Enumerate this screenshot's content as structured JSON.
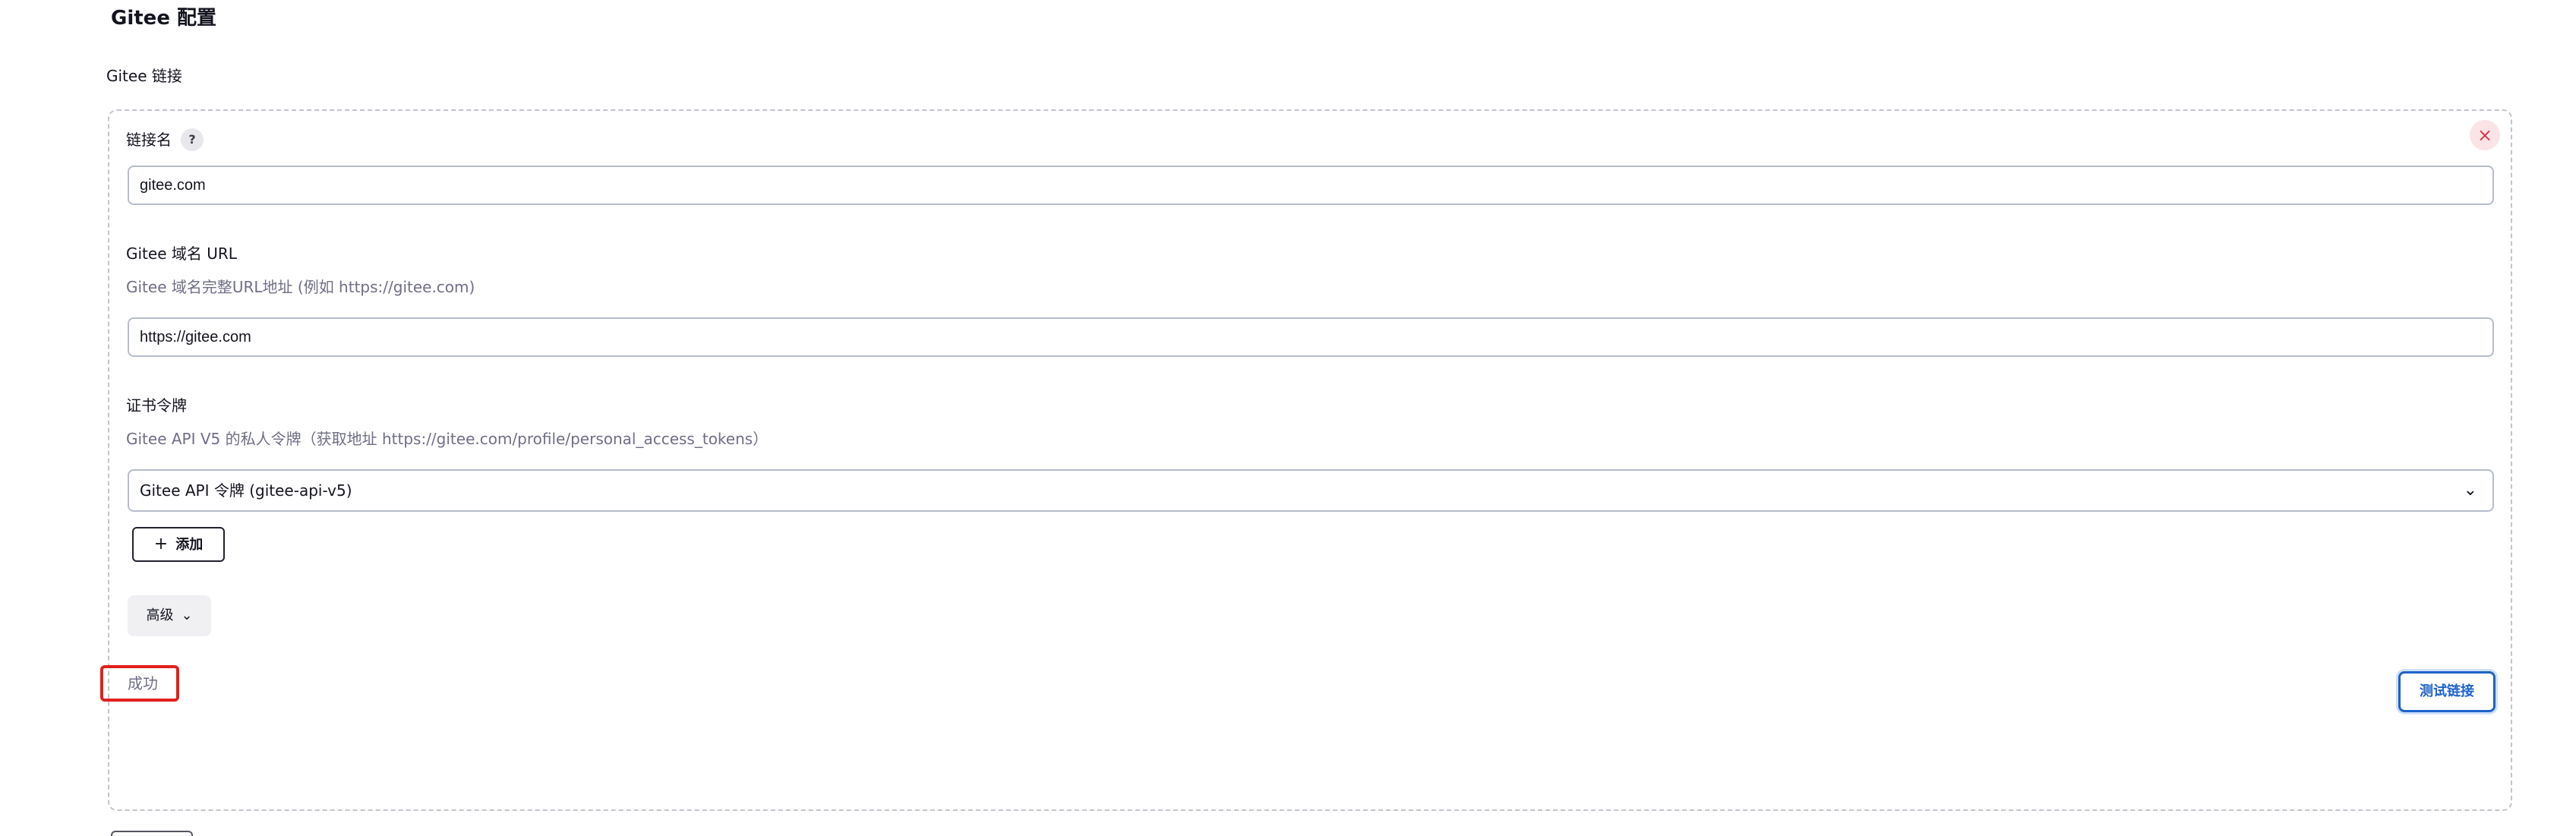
{
  "section": {
    "title": "Gitee 配置",
    "group_label": "Gitee 链接"
  },
  "connection": {
    "delete_icon": "close-icon",
    "name_field": {
      "label": "链接名",
      "help_icon": "question-icon",
      "help_text": "?",
      "value": "gitee.com"
    },
    "url_field": {
      "label": "Gitee 域名 URL",
      "description": "Gitee 域名完整URL地址 (例如 https://gitee.com)",
      "value": "https://gitee.com"
    },
    "credential_field": {
      "label": "证书令牌",
      "description": "Gitee API V5 的私人令牌（获取地址 https://gitee.com/profile/personal_access_tokens）",
      "selected": "Gitee API 令牌 (gitee-api-v5)",
      "add_button": "添加"
    },
    "advanced_button": "高级",
    "status_text": "成功",
    "test_button": "测试链接"
  },
  "colors": {
    "highlight": "#e0201b",
    "primary": "#1e63c8",
    "danger": "#d23a4a"
  }
}
